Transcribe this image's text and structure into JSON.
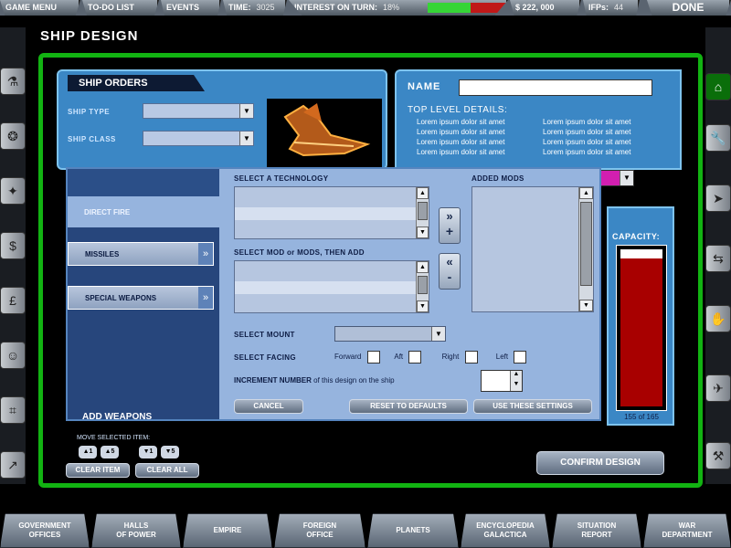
{
  "topbar": {
    "game_menu": "GAME MENU",
    "todo": "TO-DO LIST",
    "events": "EVENTS",
    "time_label": "TIME:",
    "time_value": "3025",
    "interest_label": "INTEREST ON TURN:",
    "interest_value": "18%",
    "money": "$ 222, 000",
    "ifps_label": "IFPs:",
    "ifps_value": "44",
    "done": "DONE",
    "interest_fraction": 0.55
  },
  "page_title": "SHIP DESIGN",
  "orders": {
    "title": "SHIP ORDERS",
    "ship_type": "SHIP TYPE",
    "ship_class": "SHIP CLASS"
  },
  "name_panel": {
    "name_label": "NAME",
    "name_value": "",
    "details_title": "TOP LEVEL DETAILS:",
    "lorem_col1": [
      "Lorem ipsum dolor sit amet",
      "Lorem ipsum dolor sit amet",
      "Lorem ipsum dolor sit amet",
      "Lorem ipsum dolor sit amet"
    ],
    "lorem_col2": [
      "Lorem ipsum dolor sit amet",
      "Lorem ipsum dolor sit amet",
      "Lorem ipsum dolor sit amet",
      "Lorem ipsum dolor sit amet"
    ]
  },
  "capacity": {
    "label": "CAPACITY:",
    "used": 155,
    "total": 165,
    "text": "155 of 165"
  },
  "modal": {
    "tab_direct": "DIRECT FIRE",
    "tab_missiles": "MISSILES",
    "tab_special": "SPECIAL WEAPONS",
    "add_weapons": "ADD WEAPONS",
    "select_tech": "SELECT A TECHNOLOGY",
    "added_mods": "ADDED MODS",
    "select_mod": "SELECT MOD or MODS, THEN ADD",
    "select_mount": "SELECT MOUNT",
    "select_facing": "SELECT FACING",
    "forward": "Forward",
    "aft": "Aft",
    "right": "Right",
    "left": "Left",
    "increment_a": "INCREMENT NUMBER",
    "increment_b": " of this design on the ship",
    "cancel": "CANCEL",
    "reset": "RESET TO DEFAULTS",
    "use": "USE THESE SETTINGS",
    "add_arrow": "»",
    "add_plus": "+",
    "remove_arrow": "«",
    "remove_minus": "-"
  },
  "move": {
    "label": "MOVE SELECTED ITEM:",
    "up1": "▲1",
    "up5": "▲5",
    "dn1": "▼1",
    "dn5": "▼5",
    "clear_item": "CLEAR ITEM",
    "clear_all": "CLEAR ALL"
  },
  "confirm": "CONFIRM DESIGN",
  "bottom_nav": [
    {
      "l1": "GOVERNMENT",
      "l2": "OFFICES"
    },
    {
      "l1": "HALLS",
      "l2": "OF POWER"
    },
    {
      "l1": "EMPIRE",
      "l2": ""
    },
    {
      "l1": "FOREIGN",
      "l2": "OFFICE"
    },
    {
      "l1": "PLANETS",
      "l2": ""
    },
    {
      "l1": "ENCYCLOPEDIA",
      "l2": "GALACTICA"
    },
    {
      "l1": "SITUATION",
      "l2": "REPORT"
    },
    {
      "l1": "WAR",
      "l2": "DEPARTMENT"
    }
  ],
  "left_icons": [
    "flask-icon",
    "globe-icon",
    "bird-icon",
    "dollar-icon",
    "pound-icon",
    "people-icon",
    "structure-icon",
    "chart-icon"
  ],
  "right_icons": [
    "wrench-icon",
    "ship-icon",
    "arrows-icon",
    "hand-icon",
    "fighter-icon",
    "tools-icon",
    "crest-icon"
  ],
  "colors": {
    "green_frame": "#12b312",
    "panel_blue": "#3b87c5",
    "capacity_red": "#a80000"
  }
}
